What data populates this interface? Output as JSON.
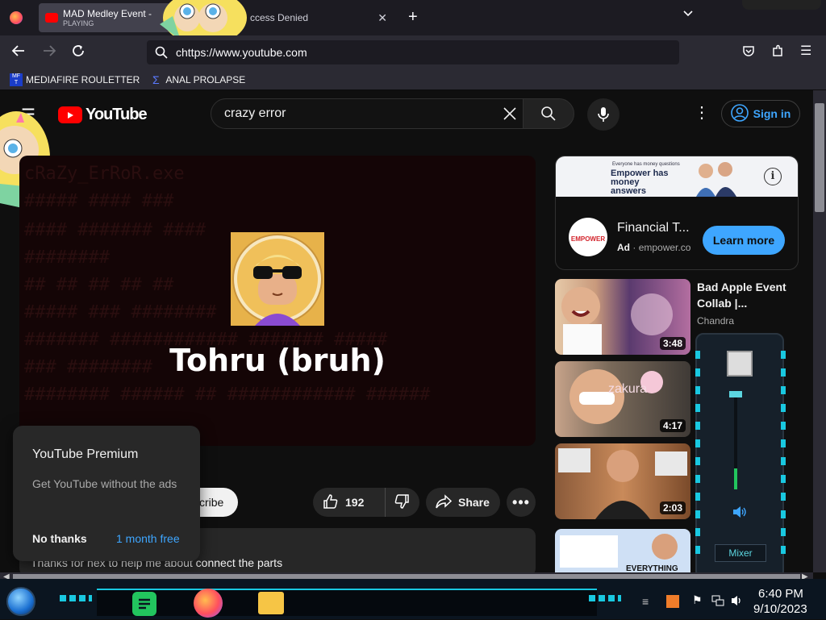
{
  "browser": {
    "tabs": [
      {
        "title": "MAD Medley Event -",
        "subtitle": "PLAYING"
      },
      {
        "title": "ccess Denied"
      }
    ],
    "url": "chttps://www.youtube.com",
    "bookmarks": [
      {
        "label": "MEDIAFIRE ROULETTER",
        "icon_text": "MF T"
      },
      {
        "label": "ANAL PROLAPSE"
      }
    ]
  },
  "youtube": {
    "logo_text": "YouTube",
    "search_value": "crazy error",
    "sign_in": "Sign in",
    "video_title": "Tohru (bruh)",
    "subscribe": "cribe",
    "likes": "192",
    "share": "Share",
    "comment_text": "Thanks for hex to help me about connect the parts",
    "premium": {
      "title": "YouTube Premium",
      "subtitle": "Get YouTube without the ads",
      "no_thanks": "No thanks",
      "free": "1 month free"
    },
    "ad": {
      "banner_small": "Everyone has money questions",
      "banner_headline": "Empower has money answers",
      "title": "Financial T...",
      "badge": "Ad",
      "domain": "empower.co",
      "cta": "Learn more",
      "logo_text": "EMPOWER"
    },
    "related": [
      {
        "title": "Bad Apple Event Collab |...",
        "channel": "Chandra",
        "duration": "3:48"
      },
      {
        "duration": "4:17",
        "overlay": "zakura"
      },
      {
        "duration": "2:03"
      },
      {
        "overlay": "EVERYTHING"
      }
    ]
  },
  "mixer": {
    "label": "Mixer",
    "level_percent": 22
  },
  "taskbar": {
    "time": "6:40 PM",
    "date": "9/10/2023"
  },
  "colors": {
    "accent": "#3ea6ff",
    "yt_red": "#ff0000",
    "taskbar_cyan": "#19c8e0"
  }
}
